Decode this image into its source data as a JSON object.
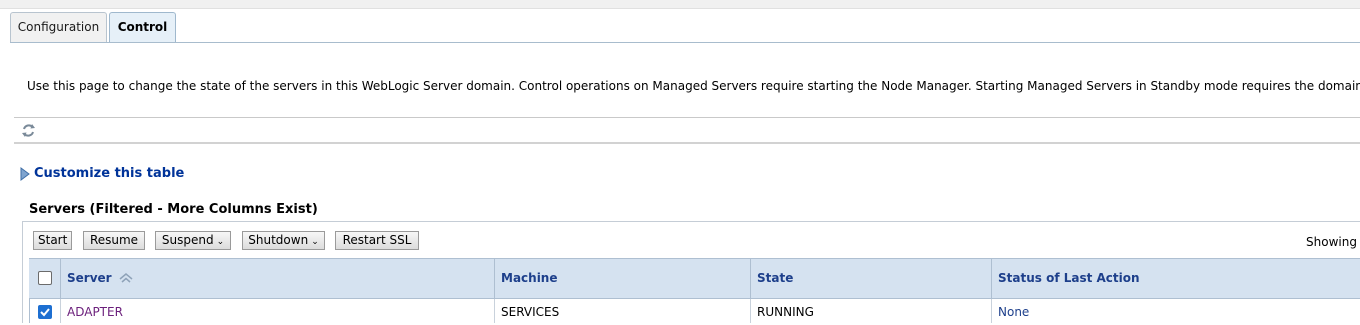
{
  "tabs": [
    {
      "label": "Configuration",
      "active": false
    },
    {
      "label": "Control",
      "active": true
    }
  ],
  "intro_text": "Use this page to change the state of the servers in this WebLogic Server domain. Control operations on Managed Servers require starting the Node Manager. Starting Managed Servers in Standby mode requires the domain-wide a",
  "customize": {
    "label": "Customize this table"
  },
  "table": {
    "title": "Servers (Filtered - More Columns Exist)",
    "toolbar": {
      "start_label": "Start",
      "resume_label": "Resume",
      "suspend_label": "Suspend",
      "shutdown_label": "Shutdown",
      "restart_ssl_label": "Restart SSL"
    },
    "showing_label": "Showing",
    "columns": {
      "server": "Server",
      "machine": "Machine",
      "state": "State",
      "status": "Status of Last Action"
    },
    "rows": [
      {
        "checked": true,
        "server": "ADAPTER",
        "machine": "SERVICES",
        "state": "RUNNING",
        "status": "None"
      }
    ]
  },
  "colors": {
    "link": "#003399",
    "header_bg": "#d5e2f0",
    "header_text": "#1d3f8b",
    "server_link": "#6b1f7b",
    "checkbox_checked": "#1d6fd1"
  },
  "icons": {
    "refresh": "refresh-icon",
    "expand": "triangle-right-icon",
    "sort": "sort-ascending-icon",
    "dropdown": "chevron-down-icon"
  }
}
